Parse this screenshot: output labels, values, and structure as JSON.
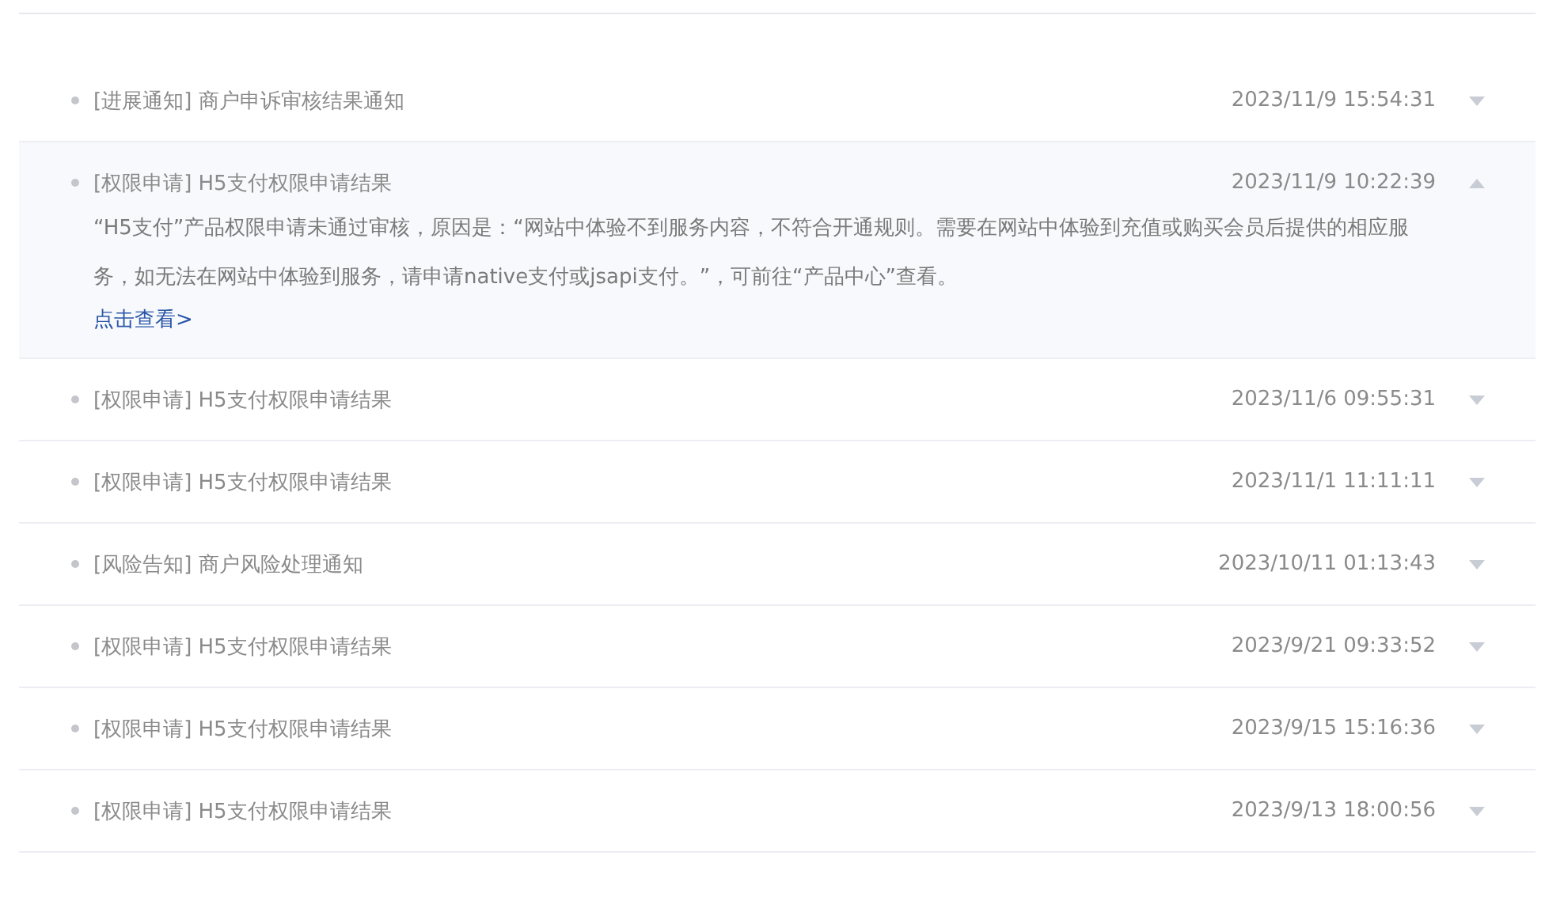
{
  "messages": [
    {
      "title": "[进展通知] 商户申诉审核结果通知",
      "time": "2023/11/9 15:54:31",
      "expanded": false
    },
    {
      "title": "[权限申请] H5支付权限申请结果",
      "time": "2023/11/9 10:22:39",
      "expanded": true,
      "body": "“H5支付”产品权限申请未通过审核，原因是：“网站中体验不到服务内容，不符合开通规则。需要在网站中体验到充值或购买会员后提供的相应服务，如无法在网站中体验到服务，请申请native支付或jsapi支付。”，可前往“产品中心”查看。",
      "link": "点击查看>"
    },
    {
      "title": "[权限申请] H5支付权限申请结果",
      "time": "2023/11/6 09:55:31",
      "expanded": false
    },
    {
      "title": "[权限申请] H5支付权限申请结果",
      "time": "2023/11/1 11:11:11",
      "expanded": false
    },
    {
      "title": "[风险告知] 商户风险处理通知",
      "time": "2023/10/11 01:13:43",
      "expanded": false
    },
    {
      "title": "[权限申请] H5支付权限申请结果",
      "time": "2023/9/21 09:33:52",
      "expanded": false
    },
    {
      "title": "[权限申请] H5支付权限申请结果",
      "time": "2023/9/15 15:16:36",
      "expanded": false
    },
    {
      "title": "[权限申请] H5支付权限申请结果",
      "time": "2023/9/13 18:00:56",
      "expanded": false
    }
  ]
}
